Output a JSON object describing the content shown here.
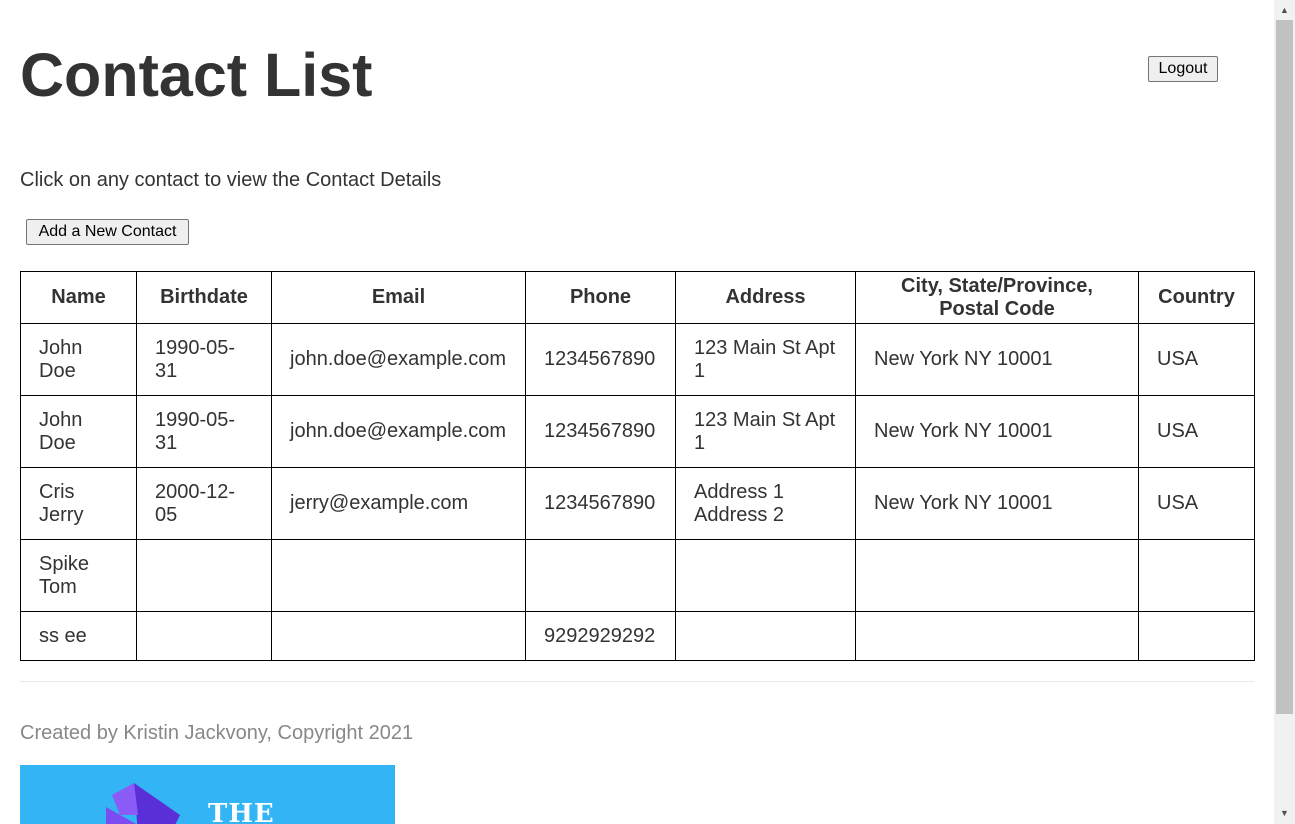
{
  "header": {
    "title": "Contact List",
    "logout_label": "Logout"
  },
  "main": {
    "hint": "Click on any contact to view the Contact Details",
    "add_label": "Add a New Contact"
  },
  "table": {
    "headers": [
      "Name",
      "Birthdate",
      "Email",
      "Phone",
      "Address",
      "City, State/Province, Postal Code",
      "Country"
    ],
    "rows": [
      [
        "John Doe",
        "1990-05-31",
        "john.doe@example.com",
        "1234567890",
        "123 Main St Apt 1",
        "New York NY 10001",
        "USA"
      ],
      [
        "John Doe",
        "1990-05-31",
        "john.doe@example.com",
        "1234567890",
        "123 Main St Apt 1",
        "New York NY 10001",
        "USA"
      ],
      [
        "Cris Jerry",
        "2000-12-05",
        "jerry@example.com",
        "1234567890",
        "Address 1 Address 2",
        "New York NY 10001",
        "USA"
      ],
      [
        "Spike Tom",
        "",
        "",
        "",
        "",
        "",
        ""
      ],
      [
        "ss ee",
        "",
        "",
        "9292929292",
        "",
        "",
        ""
      ]
    ]
  },
  "footer": {
    "text": "Created by Kristin Jackvony, Copyright 2021",
    "banner_word": "The",
    "banner_color": "#33b5f5"
  },
  "scrollbar": {
    "up_icon": "triangle-up-icon",
    "down_icon": "triangle-down-icon"
  }
}
